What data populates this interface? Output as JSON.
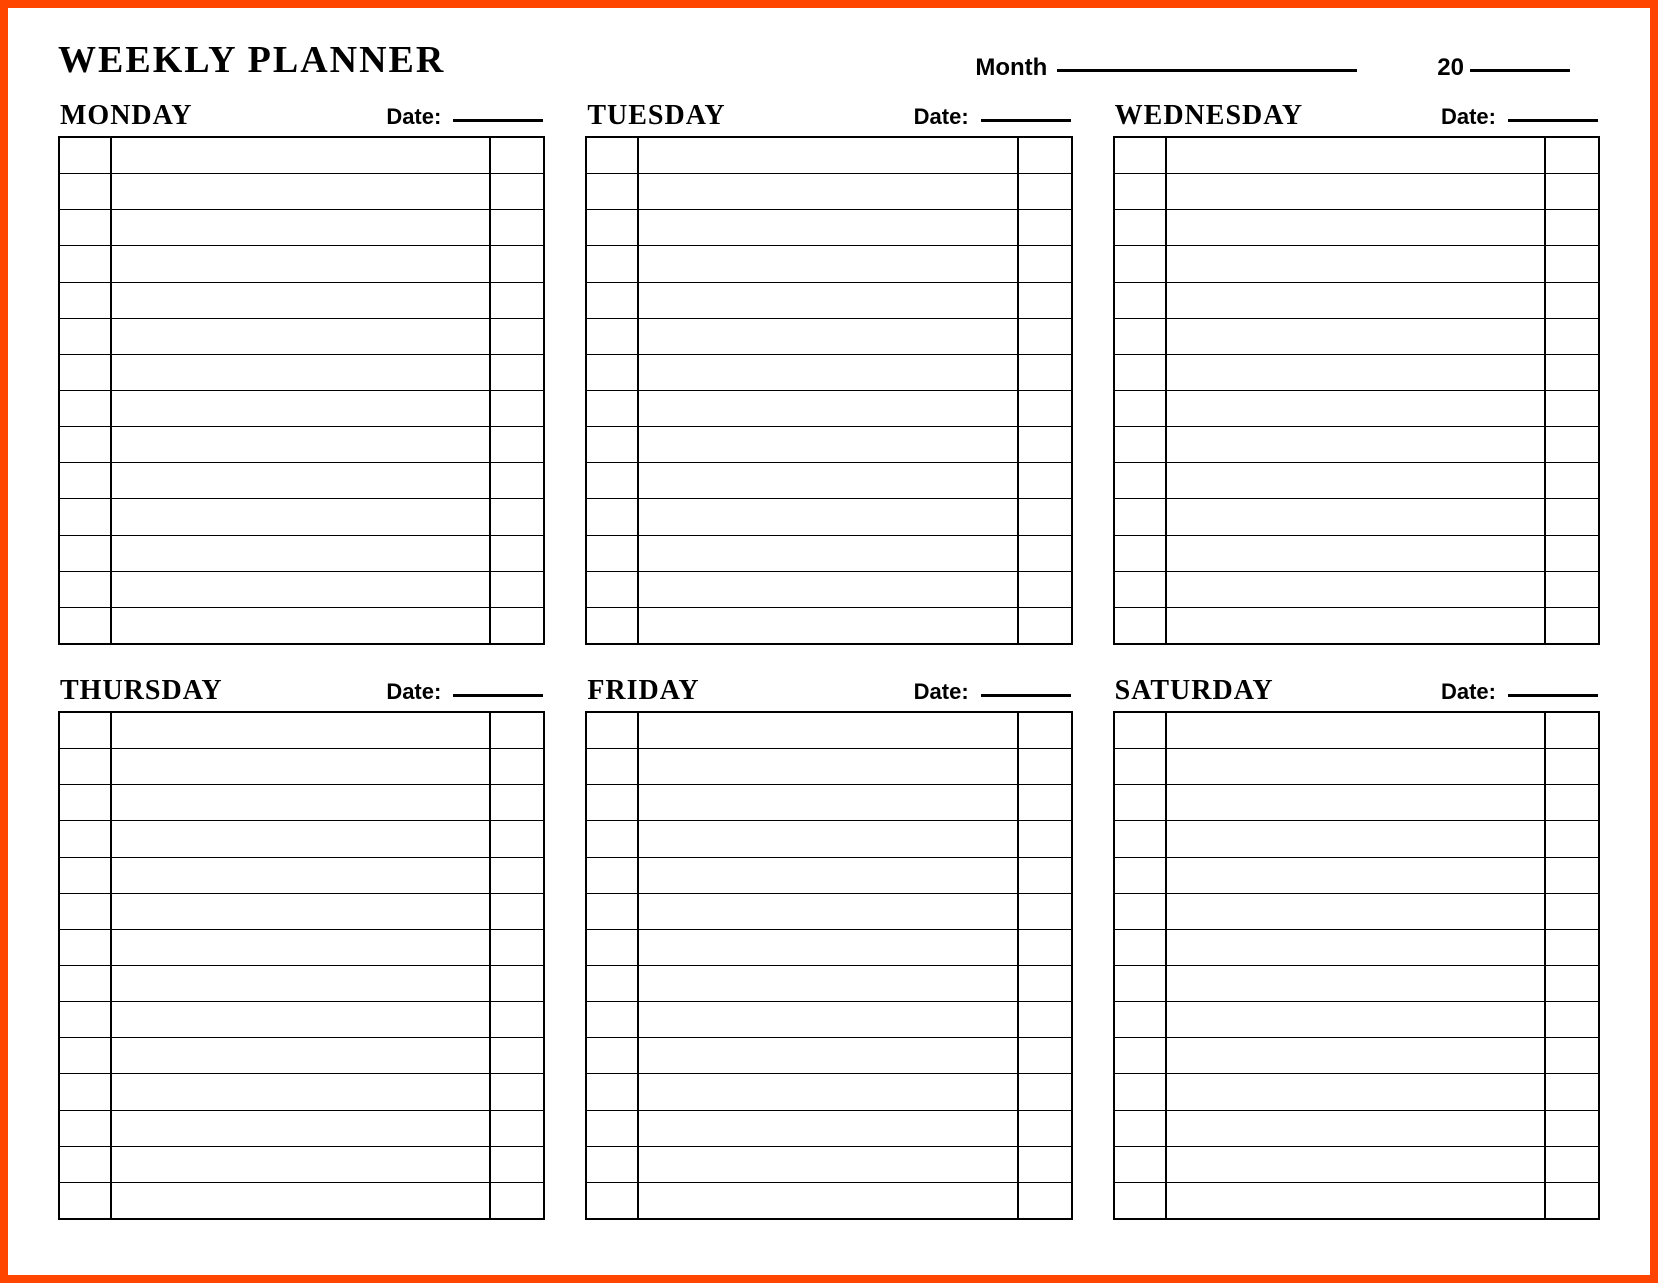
{
  "title": "Weekly Planner",
  "header": {
    "month_label": "Month",
    "year_prefix": "20"
  },
  "date_label": "Date:",
  "days": [
    {
      "name": "Monday"
    },
    {
      "name": "Tuesday"
    },
    {
      "name": "Wednesday"
    },
    {
      "name": "Thursday"
    },
    {
      "name": "Friday"
    },
    {
      "name": "Saturday"
    }
  ],
  "rows_per_day": 14
}
